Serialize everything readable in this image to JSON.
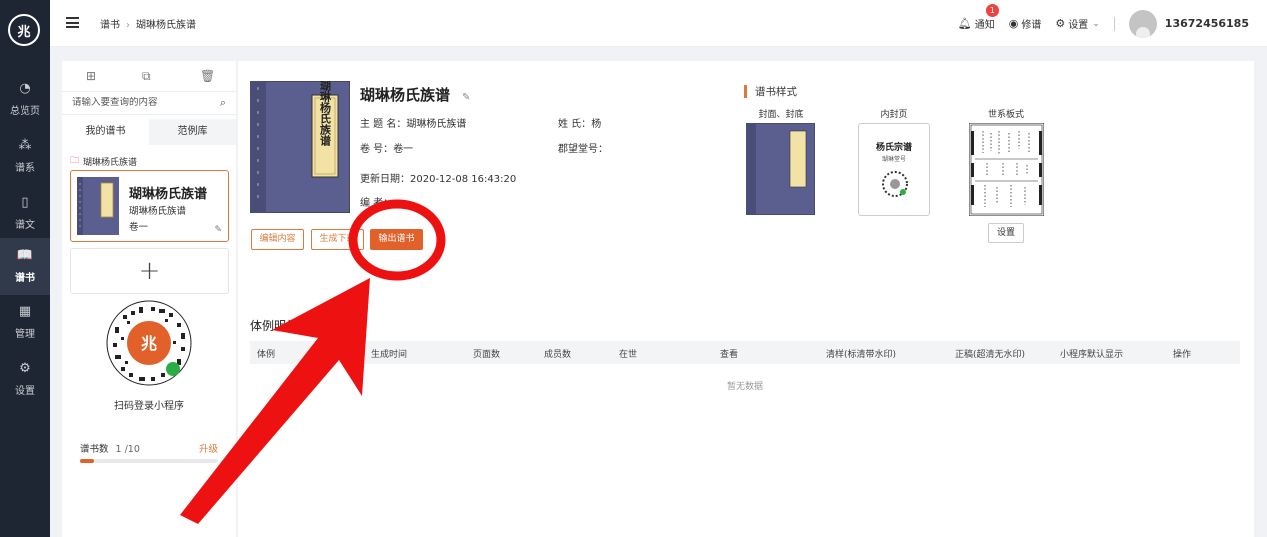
{
  "nav": {
    "logo": "兆",
    "items": [
      {
        "label": "总览页",
        "icon": "pie-chart-icon"
      },
      {
        "label": "谱系",
        "icon": "tree-icon"
      },
      {
        "label": "谱文",
        "icon": "document-icon"
      },
      {
        "label": "谱书",
        "icon": "book-icon"
      },
      {
        "label": "管理",
        "icon": "grid-icon"
      },
      {
        "label": "设置",
        "icon": "gear-icon"
      }
    ]
  },
  "header": {
    "breadcrumb": [
      "谱书",
      "瑚琳杨氏族谱"
    ],
    "notify_label": "通知",
    "notify_count": "1",
    "revise_label": "修谱",
    "settings_label": "设置",
    "username": "13672456185"
  },
  "left": {
    "search_placeholder": "请输入要查询的内容",
    "tabs": [
      "我的谱书",
      "范例库"
    ],
    "folder_label": "瑚琳杨氏族谱",
    "book": {
      "title": "瑚琳杨氏族谱",
      "subtitle": "瑚琳杨氏族谱",
      "volume": "卷一"
    },
    "add_label": "+",
    "qr_label": "扫码登录小程序",
    "quota_label": "谱书数",
    "quota_value": "1 /10",
    "quota_fraction": 0.1,
    "upgrade_label": "升级"
  },
  "book": {
    "cover_text": "瑚琳杨氏族谱",
    "title": "瑚琳杨氏族谱",
    "subject_label": "主  题  名：",
    "subject_value": "瑚琳杨氏族谱",
    "surname_label": "姓        氏：",
    "surname_value": "杨",
    "volume_label": "卷        号：",
    "volume_value": "卷一",
    "hall_label": "郡望堂号：",
    "hall_value": "",
    "updated_label": "更新日期：",
    "updated_value": "2020-12-08 16:43:20",
    "editor_label": "编        者："
  },
  "actions": {
    "edit": "编辑内容",
    "generate": "生成下载",
    "output": "输出谱书"
  },
  "styles": {
    "heading": "谱书样式",
    "cover_label": "封面、封底",
    "inner_label": "内封页",
    "tree_label": "世系板式",
    "inner_title": "杨氏宗谱",
    "inner_sub": "瑚琳堂号",
    "settings_button": "设置"
  },
  "details": {
    "heading": "体例明细(0)",
    "columns": [
      "体例",
      "生成时间",
      "页面数",
      "成员数",
      "在世",
      "查看",
      "清样(标清带水印)",
      "正稿(超清无水印)",
      "小程序默认显示",
      "操作"
    ],
    "empty_text": "暂无数据"
  },
  "colors": {
    "accent": "#e2602a",
    "accent_border": "#d97b3f",
    "nav_bg": "#1f2633",
    "cover_blue": "#5b5f8f",
    "annotation_red": "#ee1111"
  }
}
